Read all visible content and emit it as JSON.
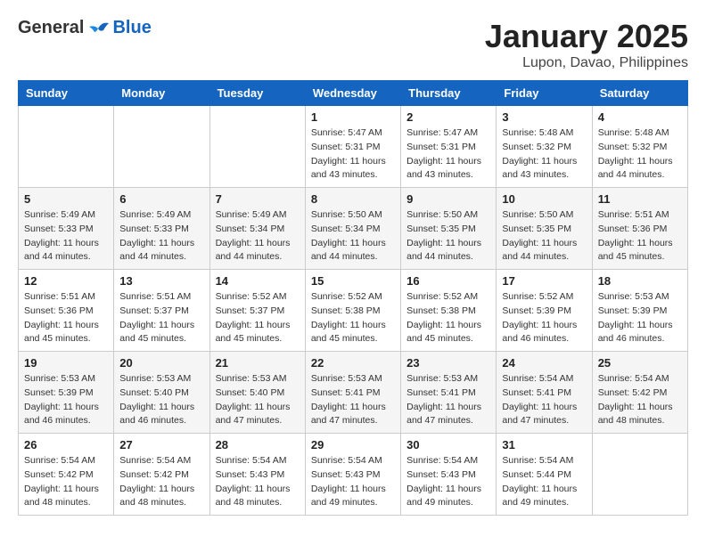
{
  "header": {
    "logo_general": "General",
    "logo_blue": "Blue",
    "month_title": "January 2025",
    "location": "Lupon, Davao, Philippines"
  },
  "days_of_week": [
    "Sunday",
    "Monday",
    "Tuesday",
    "Wednesday",
    "Thursday",
    "Friday",
    "Saturday"
  ],
  "weeks": [
    [
      {
        "num": "",
        "info": ""
      },
      {
        "num": "",
        "info": ""
      },
      {
        "num": "",
        "info": ""
      },
      {
        "num": "1",
        "info": "Sunrise: 5:47 AM\nSunset: 5:31 PM\nDaylight: 11 hours\nand 43 minutes."
      },
      {
        "num": "2",
        "info": "Sunrise: 5:47 AM\nSunset: 5:31 PM\nDaylight: 11 hours\nand 43 minutes."
      },
      {
        "num": "3",
        "info": "Sunrise: 5:48 AM\nSunset: 5:32 PM\nDaylight: 11 hours\nand 43 minutes."
      },
      {
        "num": "4",
        "info": "Sunrise: 5:48 AM\nSunset: 5:32 PM\nDaylight: 11 hours\nand 44 minutes."
      }
    ],
    [
      {
        "num": "5",
        "info": "Sunrise: 5:49 AM\nSunset: 5:33 PM\nDaylight: 11 hours\nand 44 minutes."
      },
      {
        "num": "6",
        "info": "Sunrise: 5:49 AM\nSunset: 5:33 PM\nDaylight: 11 hours\nand 44 minutes."
      },
      {
        "num": "7",
        "info": "Sunrise: 5:49 AM\nSunset: 5:34 PM\nDaylight: 11 hours\nand 44 minutes."
      },
      {
        "num": "8",
        "info": "Sunrise: 5:50 AM\nSunset: 5:34 PM\nDaylight: 11 hours\nand 44 minutes."
      },
      {
        "num": "9",
        "info": "Sunrise: 5:50 AM\nSunset: 5:35 PM\nDaylight: 11 hours\nand 44 minutes."
      },
      {
        "num": "10",
        "info": "Sunrise: 5:50 AM\nSunset: 5:35 PM\nDaylight: 11 hours\nand 44 minutes."
      },
      {
        "num": "11",
        "info": "Sunrise: 5:51 AM\nSunset: 5:36 PM\nDaylight: 11 hours\nand 45 minutes."
      }
    ],
    [
      {
        "num": "12",
        "info": "Sunrise: 5:51 AM\nSunset: 5:36 PM\nDaylight: 11 hours\nand 45 minutes."
      },
      {
        "num": "13",
        "info": "Sunrise: 5:51 AM\nSunset: 5:37 PM\nDaylight: 11 hours\nand 45 minutes."
      },
      {
        "num": "14",
        "info": "Sunrise: 5:52 AM\nSunset: 5:37 PM\nDaylight: 11 hours\nand 45 minutes."
      },
      {
        "num": "15",
        "info": "Sunrise: 5:52 AM\nSunset: 5:38 PM\nDaylight: 11 hours\nand 45 minutes."
      },
      {
        "num": "16",
        "info": "Sunrise: 5:52 AM\nSunset: 5:38 PM\nDaylight: 11 hours\nand 45 minutes."
      },
      {
        "num": "17",
        "info": "Sunrise: 5:52 AM\nSunset: 5:39 PM\nDaylight: 11 hours\nand 46 minutes."
      },
      {
        "num": "18",
        "info": "Sunrise: 5:53 AM\nSunset: 5:39 PM\nDaylight: 11 hours\nand 46 minutes."
      }
    ],
    [
      {
        "num": "19",
        "info": "Sunrise: 5:53 AM\nSunset: 5:39 PM\nDaylight: 11 hours\nand 46 minutes."
      },
      {
        "num": "20",
        "info": "Sunrise: 5:53 AM\nSunset: 5:40 PM\nDaylight: 11 hours\nand 46 minutes."
      },
      {
        "num": "21",
        "info": "Sunrise: 5:53 AM\nSunset: 5:40 PM\nDaylight: 11 hours\nand 47 minutes."
      },
      {
        "num": "22",
        "info": "Sunrise: 5:53 AM\nSunset: 5:41 PM\nDaylight: 11 hours\nand 47 minutes."
      },
      {
        "num": "23",
        "info": "Sunrise: 5:53 AM\nSunset: 5:41 PM\nDaylight: 11 hours\nand 47 minutes."
      },
      {
        "num": "24",
        "info": "Sunrise: 5:54 AM\nSunset: 5:41 PM\nDaylight: 11 hours\nand 47 minutes."
      },
      {
        "num": "25",
        "info": "Sunrise: 5:54 AM\nSunset: 5:42 PM\nDaylight: 11 hours\nand 48 minutes."
      }
    ],
    [
      {
        "num": "26",
        "info": "Sunrise: 5:54 AM\nSunset: 5:42 PM\nDaylight: 11 hours\nand 48 minutes."
      },
      {
        "num": "27",
        "info": "Sunrise: 5:54 AM\nSunset: 5:42 PM\nDaylight: 11 hours\nand 48 minutes."
      },
      {
        "num": "28",
        "info": "Sunrise: 5:54 AM\nSunset: 5:43 PM\nDaylight: 11 hours\nand 48 minutes."
      },
      {
        "num": "29",
        "info": "Sunrise: 5:54 AM\nSunset: 5:43 PM\nDaylight: 11 hours\nand 49 minutes."
      },
      {
        "num": "30",
        "info": "Sunrise: 5:54 AM\nSunset: 5:43 PM\nDaylight: 11 hours\nand 49 minutes."
      },
      {
        "num": "31",
        "info": "Sunrise: 5:54 AM\nSunset: 5:44 PM\nDaylight: 11 hours\nand 49 minutes."
      },
      {
        "num": "",
        "info": ""
      }
    ]
  ]
}
